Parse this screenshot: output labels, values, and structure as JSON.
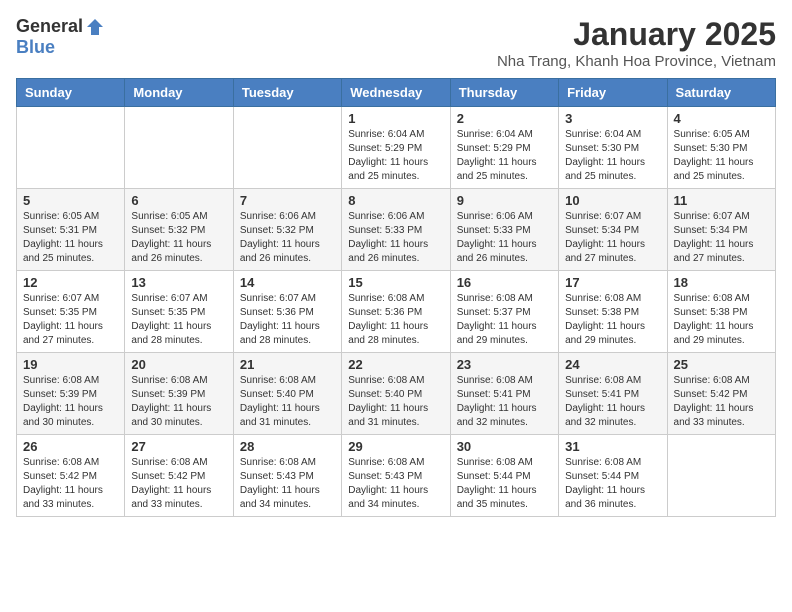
{
  "logo": {
    "general": "General",
    "blue": "Blue"
  },
  "title": "January 2025",
  "subtitle": "Nha Trang, Khanh Hoa Province, Vietnam",
  "days_of_week": [
    "Sunday",
    "Monday",
    "Tuesday",
    "Wednesday",
    "Thursday",
    "Friday",
    "Saturday"
  ],
  "weeks": [
    [
      {
        "day": "",
        "info": ""
      },
      {
        "day": "",
        "info": ""
      },
      {
        "day": "",
        "info": ""
      },
      {
        "day": "1",
        "info": "Sunrise: 6:04 AM\nSunset: 5:29 PM\nDaylight: 11 hours\nand 25 minutes."
      },
      {
        "day": "2",
        "info": "Sunrise: 6:04 AM\nSunset: 5:29 PM\nDaylight: 11 hours\nand 25 minutes."
      },
      {
        "day": "3",
        "info": "Sunrise: 6:04 AM\nSunset: 5:30 PM\nDaylight: 11 hours\nand 25 minutes."
      },
      {
        "day": "4",
        "info": "Sunrise: 6:05 AM\nSunset: 5:30 PM\nDaylight: 11 hours\nand 25 minutes."
      }
    ],
    [
      {
        "day": "5",
        "info": "Sunrise: 6:05 AM\nSunset: 5:31 PM\nDaylight: 11 hours\nand 25 minutes."
      },
      {
        "day": "6",
        "info": "Sunrise: 6:05 AM\nSunset: 5:32 PM\nDaylight: 11 hours\nand 26 minutes."
      },
      {
        "day": "7",
        "info": "Sunrise: 6:06 AM\nSunset: 5:32 PM\nDaylight: 11 hours\nand 26 minutes."
      },
      {
        "day": "8",
        "info": "Sunrise: 6:06 AM\nSunset: 5:33 PM\nDaylight: 11 hours\nand 26 minutes."
      },
      {
        "day": "9",
        "info": "Sunrise: 6:06 AM\nSunset: 5:33 PM\nDaylight: 11 hours\nand 26 minutes."
      },
      {
        "day": "10",
        "info": "Sunrise: 6:07 AM\nSunset: 5:34 PM\nDaylight: 11 hours\nand 27 minutes."
      },
      {
        "day": "11",
        "info": "Sunrise: 6:07 AM\nSunset: 5:34 PM\nDaylight: 11 hours\nand 27 minutes."
      }
    ],
    [
      {
        "day": "12",
        "info": "Sunrise: 6:07 AM\nSunset: 5:35 PM\nDaylight: 11 hours\nand 27 minutes."
      },
      {
        "day": "13",
        "info": "Sunrise: 6:07 AM\nSunset: 5:35 PM\nDaylight: 11 hours\nand 28 minutes."
      },
      {
        "day": "14",
        "info": "Sunrise: 6:07 AM\nSunset: 5:36 PM\nDaylight: 11 hours\nand 28 minutes."
      },
      {
        "day": "15",
        "info": "Sunrise: 6:08 AM\nSunset: 5:36 PM\nDaylight: 11 hours\nand 28 minutes."
      },
      {
        "day": "16",
        "info": "Sunrise: 6:08 AM\nSunset: 5:37 PM\nDaylight: 11 hours\nand 29 minutes."
      },
      {
        "day": "17",
        "info": "Sunrise: 6:08 AM\nSunset: 5:38 PM\nDaylight: 11 hours\nand 29 minutes."
      },
      {
        "day": "18",
        "info": "Sunrise: 6:08 AM\nSunset: 5:38 PM\nDaylight: 11 hours\nand 29 minutes."
      }
    ],
    [
      {
        "day": "19",
        "info": "Sunrise: 6:08 AM\nSunset: 5:39 PM\nDaylight: 11 hours\nand 30 minutes."
      },
      {
        "day": "20",
        "info": "Sunrise: 6:08 AM\nSunset: 5:39 PM\nDaylight: 11 hours\nand 30 minutes."
      },
      {
        "day": "21",
        "info": "Sunrise: 6:08 AM\nSunset: 5:40 PM\nDaylight: 11 hours\nand 31 minutes."
      },
      {
        "day": "22",
        "info": "Sunrise: 6:08 AM\nSunset: 5:40 PM\nDaylight: 11 hours\nand 31 minutes."
      },
      {
        "day": "23",
        "info": "Sunrise: 6:08 AM\nSunset: 5:41 PM\nDaylight: 11 hours\nand 32 minutes."
      },
      {
        "day": "24",
        "info": "Sunrise: 6:08 AM\nSunset: 5:41 PM\nDaylight: 11 hours\nand 32 minutes."
      },
      {
        "day": "25",
        "info": "Sunrise: 6:08 AM\nSunset: 5:42 PM\nDaylight: 11 hours\nand 33 minutes."
      }
    ],
    [
      {
        "day": "26",
        "info": "Sunrise: 6:08 AM\nSunset: 5:42 PM\nDaylight: 11 hours\nand 33 minutes."
      },
      {
        "day": "27",
        "info": "Sunrise: 6:08 AM\nSunset: 5:42 PM\nDaylight: 11 hours\nand 33 minutes."
      },
      {
        "day": "28",
        "info": "Sunrise: 6:08 AM\nSunset: 5:43 PM\nDaylight: 11 hours\nand 34 minutes."
      },
      {
        "day": "29",
        "info": "Sunrise: 6:08 AM\nSunset: 5:43 PM\nDaylight: 11 hours\nand 34 minutes."
      },
      {
        "day": "30",
        "info": "Sunrise: 6:08 AM\nSunset: 5:44 PM\nDaylight: 11 hours\nand 35 minutes."
      },
      {
        "day": "31",
        "info": "Sunrise: 6:08 AM\nSunset: 5:44 PM\nDaylight: 11 hours\nand 36 minutes."
      },
      {
        "day": "",
        "info": ""
      }
    ]
  ]
}
